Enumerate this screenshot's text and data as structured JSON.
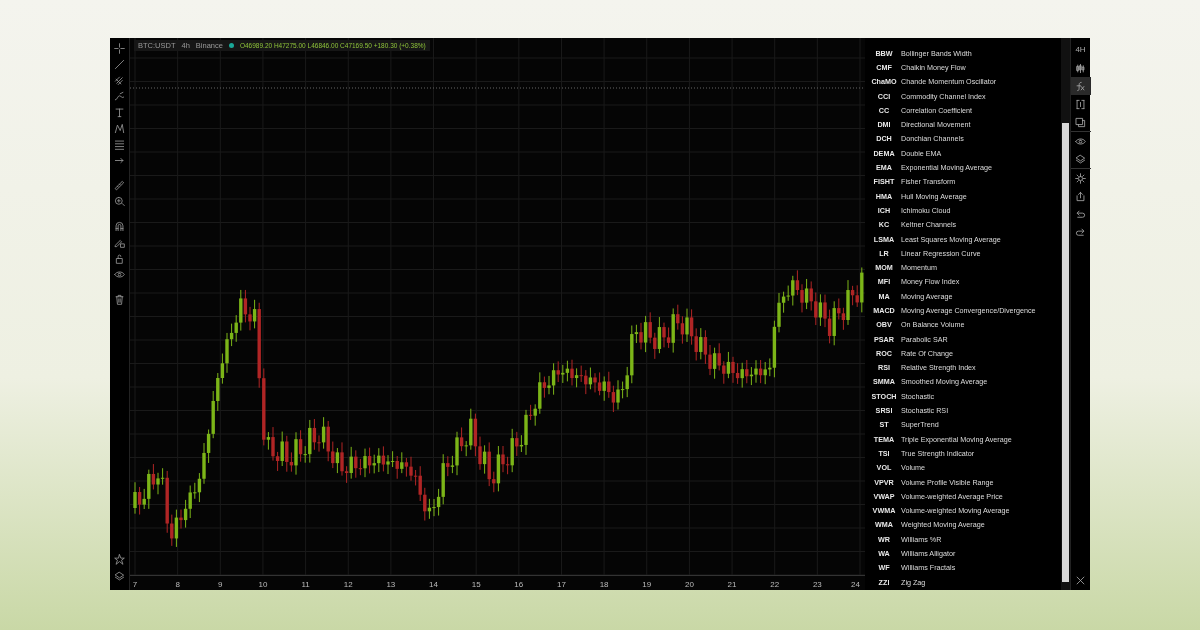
{
  "chart": {
    "symbol": "BTC:USDT",
    "interval": "4h",
    "exchange": "Binance",
    "ohlc": "O46989.20 H47275.00 L46846.00 C47169.50 +180.30 (+0.38%)",
    "x_labels": [
      "7",
      "8",
      "9",
      "10",
      "11",
      "12",
      "13",
      "14",
      "15",
      "16",
      "17",
      "18",
      "19",
      "20",
      "21",
      "22",
      "23",
      "24"
    ]
  },
  "indicators": [
    {
      "code": "BBW",
      "name": "Bollinger Bands Width"
    },
    {
      "code": "CMF",
      "name": "Chaikin Money Flow"
    },
    {
      "code": "ChaMO",
      "name": "Chande Momentum Oscillator"
    },
    {
      "code": "CCI",
      "name": "Commodity Channel Index"
    },
    {
      "code": "CC",
      "name": "Correlation Coefficient"
    },
    {
      "code": "DMI",
      "name": "Directional Movement"
    },
    {
      "code": "DCH",
      "name": "Donchian Channels"
    },
    {
      "code": "DEMA",
      "name": "Double EMA"
    },
    {
      "code": "EMA",
      "name": "Exponential Moving Average"
    },
    {
      "code": "FISHT",
      "name": "Fisher Transform"
    },
    {
      "code": "HMA",
      "name": "Hull Moving Average"
    },
    {
      "code": "ICH",
      "name": "Ichimoku Cloud"
    },
    {
      "code": "KC",
      "name": "Keltner Channels"
    },
    {
      "code": "LSMA",
      "name": "Least Squares Moving Average"
    },
    {
      "code": "LR",
      "name": "Linear Regression Curve"
    },
    {
      "code": "MOM",
      "name": "Momentum"
    },
    {
      "code": "MFI",
      "name": "Money Flow Index"
    },
    {
      "code": "MA",
      "name": "Moving Average"
    },
    {
      "code": "MACD",
      "name": "Moving Average Convergence/Divergence"
    },
    {
      "code": "OBV",
      "name": "On Balance Volume"
    },
    {
      "code": "PSAR",
      "name": "Parabolic SAR"
    },
    {
      "code": "ROC",
      "name": "Rate Of Change"
    },
    {
      "code": "RSI",
      "name": "Relative Strength Index"
    },
    {
      "code": "SMMA",
      "name": "Smoothed Moving Average"
    },
    {
      "code": "STOCH",
      "name": "Stochastic"
    },
    {
      "code": "SRSI",
      "name": "Stochastic RSI"
    },
    {
      "code": "ST",
      "name": "SuperTrend"
    },
    {
      "code": "TEMA",
      "name": "Triple Exponential Moving Average"
    },
    {
      "code": "TSI",
      "name": "True Strength Indicator"
    },
    {
      "code": "VOL",
      "name": "Volume"
    },
    {
      "code": "VPVR",
      "name": "Volume Profile Visible Range"
    },
    {
      "code": "VWAP",
      "name": "Volume-weighted Average Price"
    },
    {
      "code": "VWMA",
      "name": "Volume-weighted Moving Average"
    },
    {
      "code": "WMA",
      "name": "Weighted Moving Average"
    },
    {
      "code": "WR",
      "name": "Williams %R"
    },
    {
      "code": "WA",
      "name": "Williams Alligator"
    },
    {
      "code": "WF",
      "name": "Williams Fractals"
    },
    {
      "code": "ZZI",
      "name": "Zig Zag"
    }
  ],
  "right_toolbar": {
    "interval": "4H",
    "tools": [
      {
        "kind": "candles",
        "selected": false
      },
      {
        "kind": "fx",
        "selected": true
      },
      {
        "kind": "bracket",
        "selected": false
      },
      {
        "kind": "copy",
        "selected": false
      },
      {
        "kind": "eye",
        "selected": false
      },
      {
        "kind": "layers",
        "selected": false
      },
      {
        "kind": "gear",
        "selected": false
      },
      {
        "kind": "share",
        "selected": false
      },
      {
        "kind": "undo",
        "selected": false
      },
      {
        "kind": "redo",
        "selected": false
      }
    ]
  }
}
